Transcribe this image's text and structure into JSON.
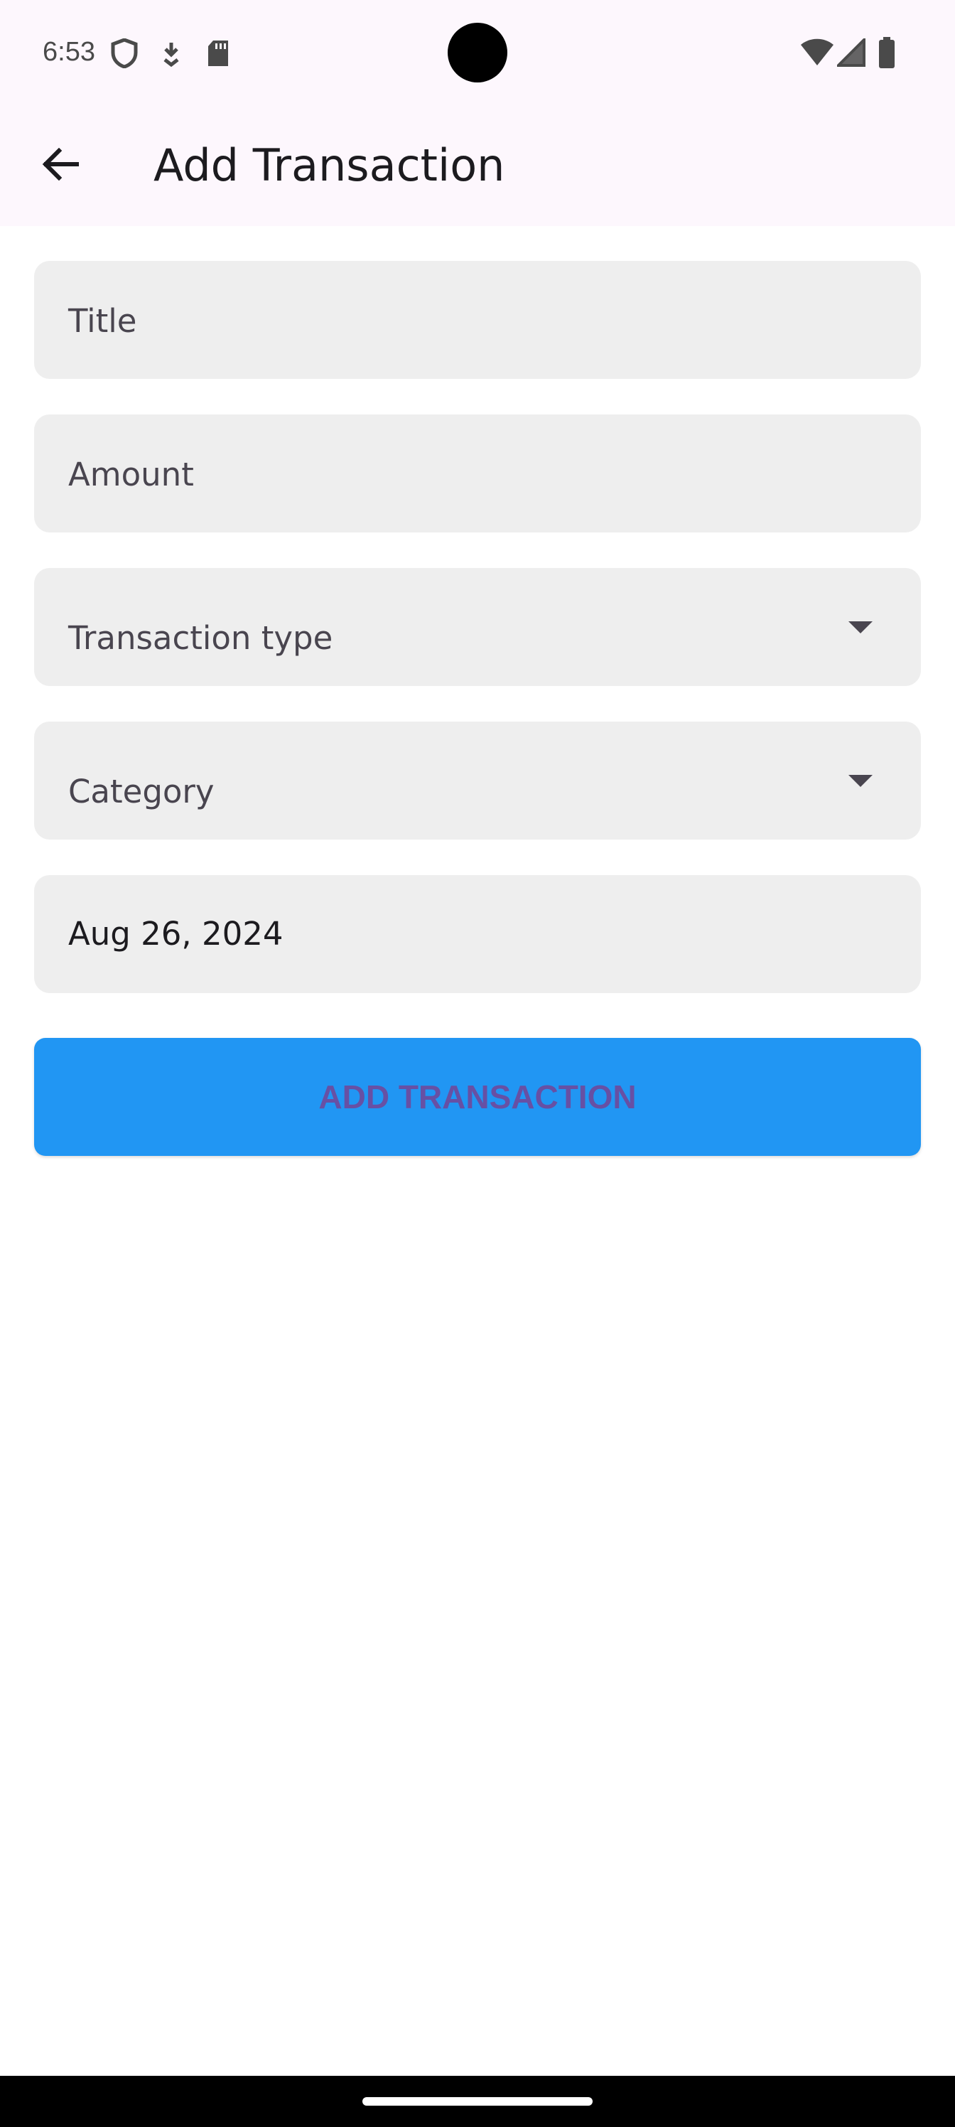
{
  "status_bar": {
    "time": "6:53",
    "left_icons": [
      "shield-icon",
      "download-icon",
      "sd-card-icon"
    ],
    "right_icons": [
      "wifi-icon",
      "cell-signal-icon",
      "battery-icon"
    ]
  },
  "app_bar": {
    "title": "Add Transaction",
    "back_icon": "arrow-back-icon"
  },
  "form": {
    "title_field": {
      "placeholder": "Title",
      "value": ""
    },
    "amount_field": {
      "placeholder": "Amount",
      "value": ""
    },
    "transaction_type_field": {
      "label": "Transaction type",
      "selected": ""
    },
    "category_field": {
      "label": "Category",
      "selected": ""
    },
    "date_field": {
      "value": "Aug 26, 2024"
    },
    "submit_label": "ADD TRANSACTION"
  },
  "colors": {
    "app_bar_bg": "#fdf7fd",
    "field_bg": "#eeeeee",
    "button_bg": "#2196f3",
    "button_text": "#6750a4"
  }
}
